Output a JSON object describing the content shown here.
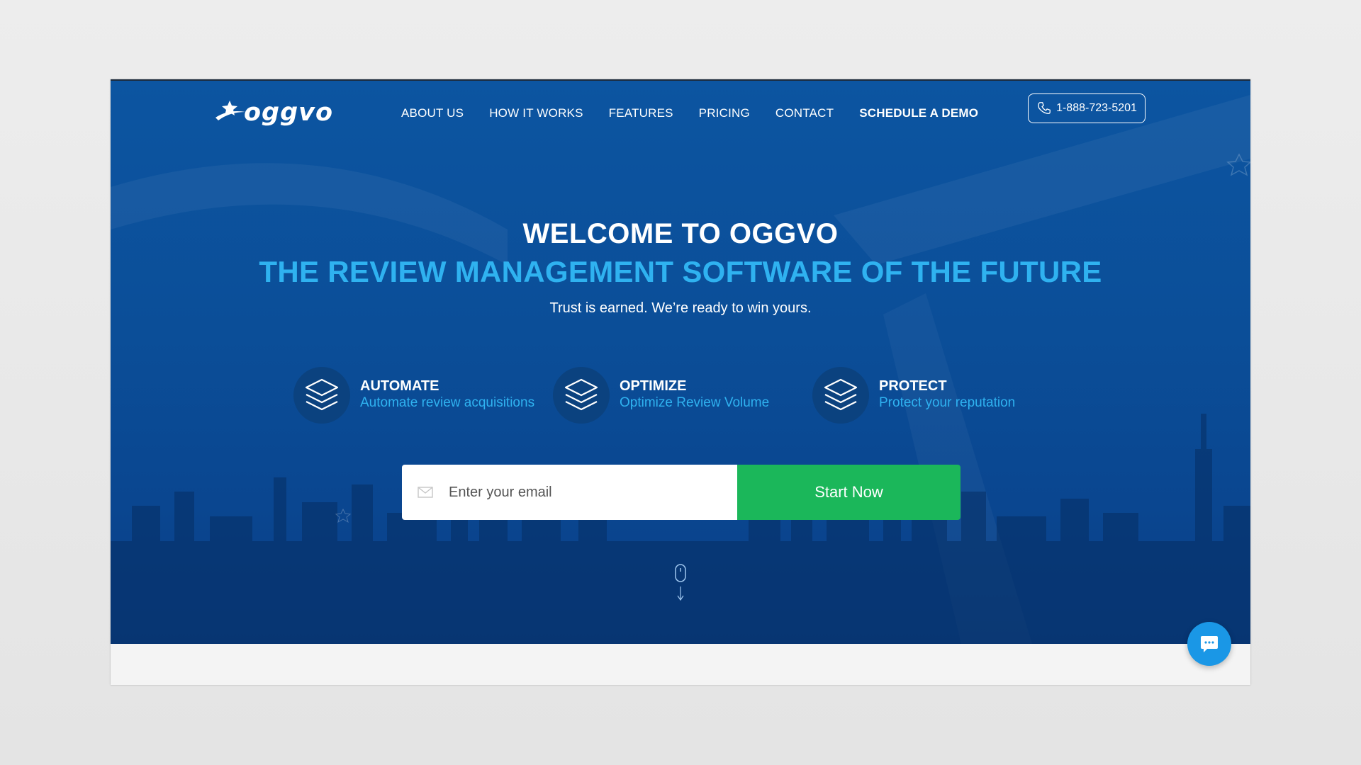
{
  "brand": {
    "logo_text": "oggvo"
  },
  "nav": {
    "items": [
      "ABOUT US",
      "HOW IT WORKS",
      "FEATURES",
      "PRICING",
      "CONTACT",
      "SCHEDULE A DEMO"
    ],
    "phone": "1-888-723-5201"
  },
  "hero": {
    "title": "WELCOME TO OGGVO",
    "subtitle": "THE REVIEW MANAGEMENT SOFTWARE OF THE FUTURE",
    "tagline": "Trust is earned. We’re ready to win yours."
  },
  "features": [
    {
      "title": "AUTOMATE",
      "desc": "Automate review acquisitions",
      "icon": "layers-icon"
    },
    {
      "title": "OPTIMIZE",
      "desc": "Optimize Review Volume",
      "icon": "layers-icon"
    },
    {
      "title": "PROTECT",
      "desc": "Protect your reputation",
      "icon": "layers-icon"
    }
  ],
  "signup": {
    "email_placeholder": "Enter your email",
    "button": "Start Now"
  },
  "colors": {
    "hero_blue": "#0b4e98",
    "accent_cyan": "#2fb2f0",
    "cta_green": "#1bb75a",
    "chat_blue": "#1a97e6"
  }
}
